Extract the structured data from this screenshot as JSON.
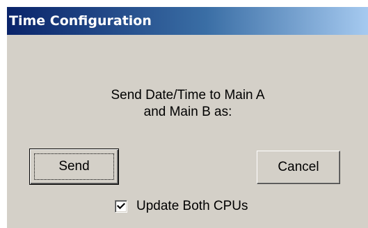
{
  "window": {
    "title": "Time Configuration"
  },
  "message": {
    "line1": "Send Date/Time to Main A",
    "line2": "and Main B as:"
  },
  "buttons": {
    "send_label": "Send",
    "cancel_label": "Cancel"
  },
  "options": {
    "update_both_cpus_label": "Update Both CPUs",
    "update_both_cpus_checked": true
  },
  "icons": {
    "checkbox_mark": "check-icon"
  },
  "colors": {
    "title_gradient_start": "#0a246a",
    "title_gradient_end": "#a6caf0",
    "dialog_face": "#d4d0c8",
    "title_text": "#ffffff"
  }
}
